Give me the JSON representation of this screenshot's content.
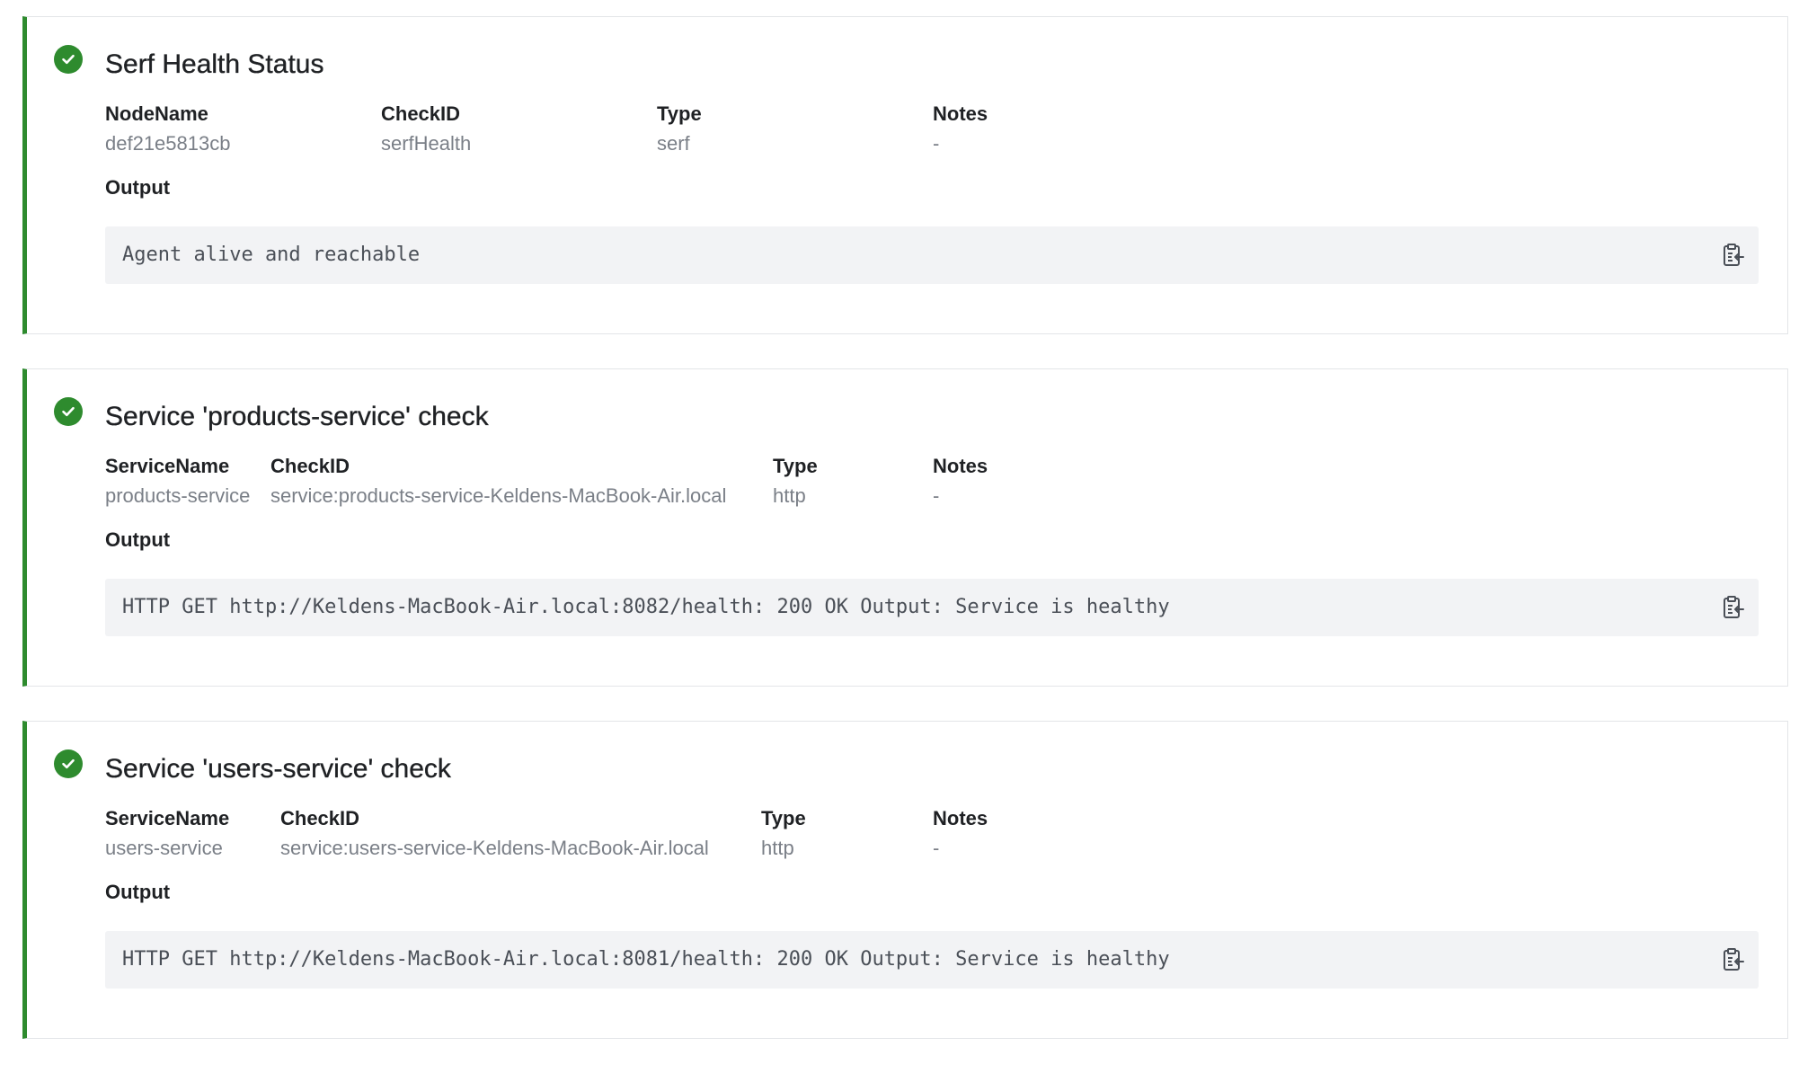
{
  "colors": {
    "passing": "#2e8b2e",
    "card_border": "#e3e5e8",
    "output_bg": "#f2f3f5",
    "muted_text": "#7a7f87"
  },
  "checks": [
    {
      "status": "passing",
      "status_icon": "check-circle-icon",
      "title": "Serf Health Status",
      "fields": [
        {
          "label": "NodeName",
          "value": "def21e5813cb"
        },
        {
          "label": "CheckID",
          "value": "serfHealth"
        },
        {
          "label": "Type",
          "value": "serf"
        },
        {
          "label": "Notes",
          "value": "-"
        }
      ],
      "output_label": "Output",
      "output": "Agent alive and reachable",
      "copy_icon": "clipboard-copy-icon"
    },
    {
      "status": "passing",
      "status_icon": "check-circle-icon",
      "title": "Service 'products-service' check",
      "fields": [
        {
          "label": "ServiceName",
          "value": "products-service"
        },
        {
          "label": "CheckID",
          "value": "service:products-service-Keldens-MacBook-Air.local"
        },
        {
          "label": "Type",
          "value": "http"
        },
        {
          "label": "Notes",
          "value": "-"
        }
      ],
      "output_label": "Output",
      "output": "HTTP GET http://Keldens-MacBook-Air.local:8082/health: 200 OK Output: Service is healthy",
      "copy_icon": "clipboard-copy-icon"
    },
    {
      "status": "passing",
      "status_icon": "check-circle-icon",
      "title": "Service 'users-service' check",
      "fields": [
        {
          "label": "ServiceName",
          "value": "users-service"
        },
        {
          "label": "CheckID",
          "value": "service:users-service-Keldens-MacBook-Air.local"
        },
        {
          "label": "Type",
          "value": "http"
        },
        {
          "label": "Notes",
          "value": "-"
        }
      ],
      "output_label": "Output",
      "output": "HTTP GET http://Keldens-MacBook-Air.local:8081/health: 200 OK Output: Service is healthy",
      "copy_icon": "clipboard-copy-icon"
    }
  ]
}
